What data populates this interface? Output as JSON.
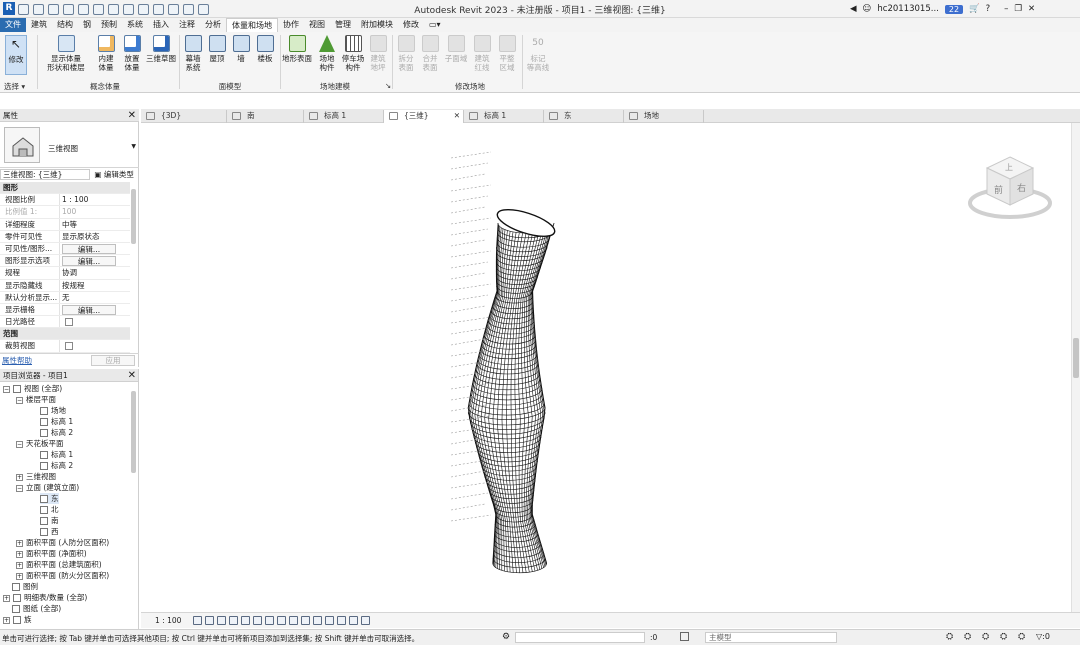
{
  "app": {
    "title": "Autodesk Revit 2023 - 未注册版 - 项目1 - 三维视图: {三维}",
    "user": "hc20113015...",
    "badge": "22",
    "logo": "R"
  },
  "menu": [
    "文件",
    "建筑",
    "结构",
    "钢",
    "预制",
    "系统",
    "插入",
    "注释",
    "分析",
    "体量和场地",
    "协作",
    "视图",
    "管理",
    "附加模块",
    "修改"
  ],
  "ribbon": {
    "modify": "修改",
    "select": "选择",
    "show_mass": "显示体量\n形状和楼层",
    "inplace_mass": "内建\n体量",
    "place_mass": "放置\n体量",
    "sketch3d": "三维草图",
    "concept_mass_panel": "概念体量",
    "curtain_system": "幕墙\n系统",
    "roof": "屋顶",
    "wall": "墙",
    "floor": "楼板",
    "face_model_panel": "面模型",
    "toposurface": "地形表面",
    "site_component": "场地\n构件",
    "parking_component": "停车场\n构件",
    "building_pad": "建筑\n地坪",
    "site_model_panel": "场地建模",
    "split_surface": "拆分\n表面",
    "merge_surface": "合并\n表面",
    "subregion": "子面域",
    "property_line": "建筑\n红线",
    "graded_region": "平整\n区域",
    "label_contour": "标记\n等高线",
    "modify_site_panel": "修改场地",
    "label_50": "50"
  },
  "tabs": [
    {
      "label": "{3D}"
    },
    {
      "label": "南"
    },
    {
      "label": "标高 1"
    },
    {
      "label": "{三维}"
    },
    {
      "label": "标高 1"
    },
    {
      "label": "东"
    },
    {
      "label": "场地"
    }
  ],
  "properties": {
    "title": "属性",
    "type_name": "三维视图",
    "instance": "三维视图: {三维}",
    "edit_type": "编辑类型",
    "group_graphics": "图形",
    "rows": [
      {
        "k": "视图比例",
        "v": "1 : 100"
      },
      {
        "k": "比例值 1:",
        "v": "100"
      },
      {
        "k": "详细程度",
        "v": "中等"
      },
      {
        "k": "零件可见性",
        "v": "显示原状态"
      },
      {
        "k": "可见性/图形...",
        "v": "编辑..."
      },
      {
        "k": "图形显示选项",
        "v": "编辑..."
      },
      {
        "k": "规程",
        "v": "协调"
      },
      {
        "k": "显示隐藏线",
        "v": "按规程"
      },
      {
        "k": "默认分析显示...",
        "v": "无"
      },
      {
        "k": "显示栅格",
        "v": "编辑..."
      },
      {
        "k": "日光路径",
        "v": ""
      }
    ],
    "group_extents": "范围",
    "crop_view": "裁剪视图",
    "help": "属性帮助",
    "apply": "应用"
  },
  "browser": {
    "title": "项目浏览器 - 项目1",
    "nodes": [
      {
        "label": "视图 (全部)"
      },
      {
        "label": "楼层平面"
      },
      {
        "label": "场地"
      },
      {
        "label": "标高 1"
      },
      {
        "label": "标高 2"
      },
      {
        "label": "天花板平面"
      },
      {
        "label": "标高 1"
      },
      {
        "label": "标高 2"
      },
      {
        "label": "三维视图"
      },
      {
        "label": "立面 (建筑立面)"
      },
      {
        "label": "东"
      },
      {
        "label": "北"
      },
      {
        "label": "南"
      },
      {
        "label": "西"
      },
      {
        "label": "面积平面 (人防分区面积)"
      },
      {
        "label": "面积平面 (净面积)"
      },
      {
        "label": "面积平面 (总建筑面积)"
      },
      {
        "label": "面积平面 (防火分区面积)"
      },
      {
        "label": "图例"
      },
      {
        "label": "明细表/数量 (全部)"
      },
      {
        "label": "图纸 (全部)"
      },
      {
        "label": "族"
      }
    ]
  },
  "viewcube": {
    "top": "上",
    "front": "前",
    "right": "右"
  },
  "viewbar": {
    "scale": "1 : 100"
  },
  "status": {
    "text": "单击可进行选择; 按 Tab 键并单击可选择其他项目; 按 Ctrl 键并单击可将新项目添加到选择集; 按 Shift 键并单击可取消选择。",
    "model": "主模型",
    "count": ":0",
    "filter_count": ":0"
  }
}
